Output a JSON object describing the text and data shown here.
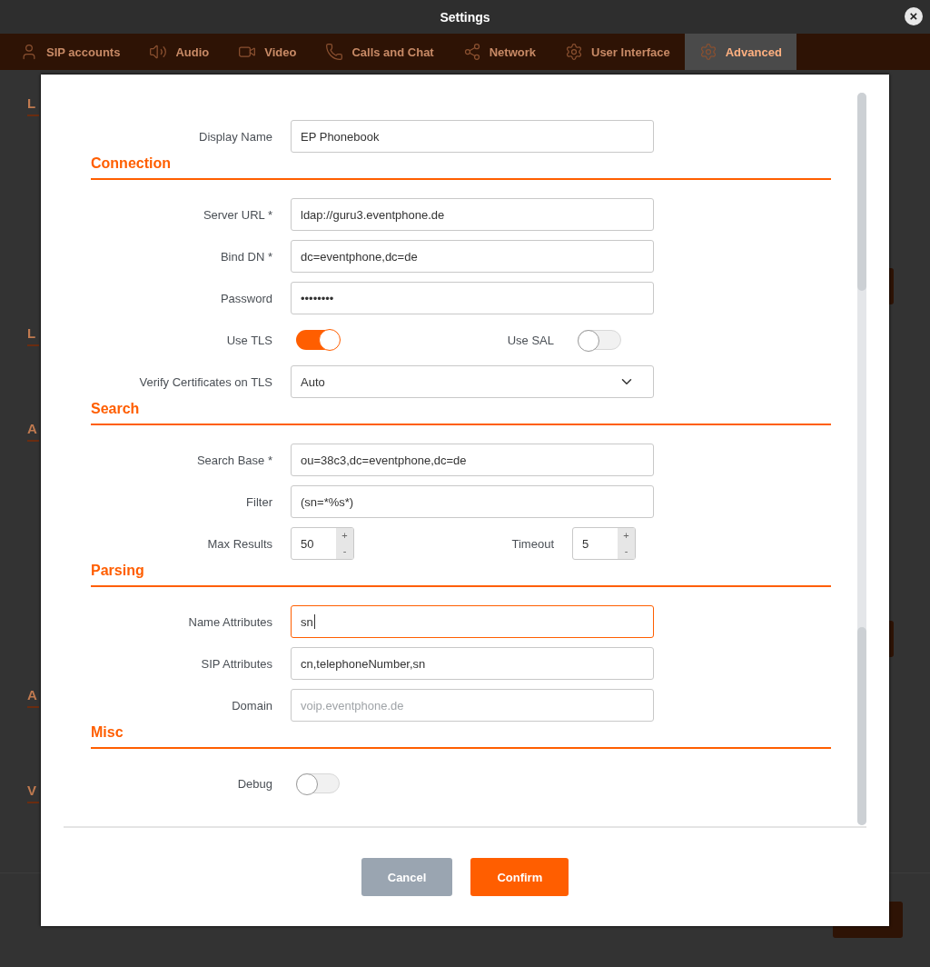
{
  "window": {
    "title": "Settings",
    "close": "×"
  },
  "tabs": [
    {
      "label": "SIP accounts",
      "selected": false
    },
    {
      "label": "Audio",
      "selected": false
    },
    {
      "label": "Video",
      "selected": false
    },
    {
      "label": "Calls and Chat",
      "selected": false
    },
    {
      "label": "Network",
      "selected": false
    },
    {
      "label": "User Interface",
      "selected": false
    },
    {
      "label": "Advanced",
      "selected": true
    }
  ],
  "background_sections": [
    "L",
    "L",
    "A",
    "A",
    "V"
  ],
  "dialog": {
    "top_rows": [
      {
        "items": [
          {
            "label": "Display Name",
            "kind": "text",
            "value": "EP Phonebook"
          }
        ]
      }
    ],
    "sections": [
      {
        "title": "Connection",
        "rows": [
          {
            "items": [
              {
                "label": "Server URL *",
                "kind": "text",
                "value": "ldap://guru3.eventphone.de"
              }
            ]
          },
          {
            "items": [
              {
                "label": "Bind DN *",
                "kind": "text",
                "value": "dc=eventphone,dc=de"
              }
            ]
          },
          {
            "items": [
              {
                "label": "Password",
                "kind": "text",
                "value": "••••••••"
              }
            ]
          },
          {
            "items": [
              {
                "label": "Use TLS",
                "kind": "toggle",
                "on": true
              },
              {
                "label": "Use SAL",
                "kind": "toggle",
                "on": false
              }
            ]
          },
          {
            "items": [
              {
                "label": "Verify Certificates on TLS",
                "kind": "select",
                "value": "Auto"
              }
            ]
          }
        ]
      },
      {
        "title": "Search",
        "rows": [
          {
            "items": [
              {
                "label": "Search Base *",
                "kind": "text",
                "value": "ou=38c3,dc=eventphone,dc=de"
              }
            ]
          },
          {
            "items": [
              {
                "label": "Filter",
                "kind": "text",
                "value": "(sn=*%s*)"
              }
            ]
          },
          {
            "items": [
              {
                "label": "Max Results",
                "kind": "spin",
                "value": "50",
                "increment": "+",
                "decrement": "-"
              },
              {
                "label": "Timeout",
                "kind": "spin",
                "value": "5",
                "increment": "+",
                "decrement": "-"
              }
            ]
          }
        ]
      },
      {
        "title": "Parsing",
        "rows": [
          {
            "items": [
              {
                "label": "Name Attributes",
                "kind": "text",
                "value": "sn",
                "focused": true
              }
            ]
          },
          {
            "items": [
              {
                "label": "SIP Attributes",
                "kind": "text",
                "value": "cn,telephoneNumber,sn"
              }
            ]
          },
          {
            "items": [
              {
                "label": "Domain",
                "kind": "text",
                "placeholder": "voip.eventphone.de"
              }
            ]
          }
        ]
      },
      {
        "title": "Misc",
        "rows": [
          {
            "items": [
              {
                "label": "Debug",
                "kind": "toggle",
                "on": false
              }
            ]
          }
        ]
      }
    ],
    "buttons": [
      {
        "label": "Cancel",
        "kind": "secondary"
      },
      {
        "label": "Confirm",
        "kind": "primary"
      }
    ]
  }
}
